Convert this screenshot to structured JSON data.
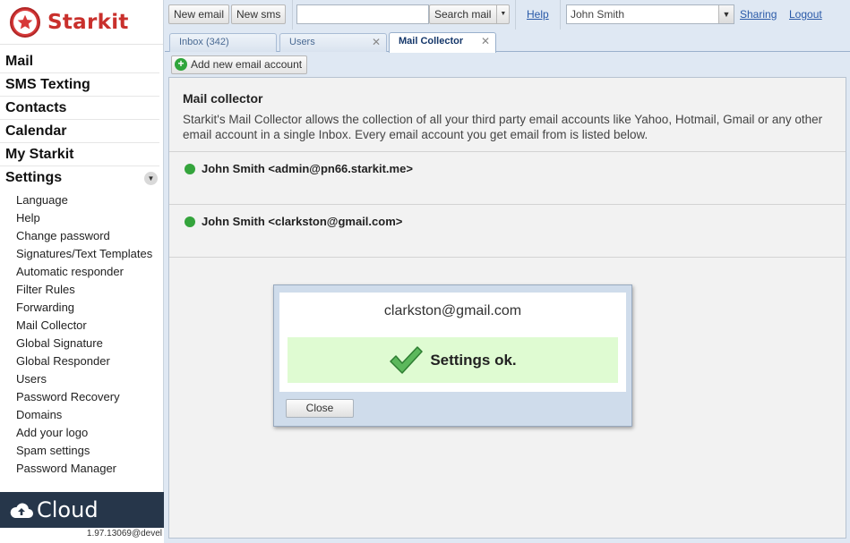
{
  "brand": {
    "name": "Starkit"
  },
  "nav": {
    "main": [
      "Mail",
      "SMS Texting",
      "Contacts",
      "Calendar",
      "My Starkit",
      "Settings"
    ],
    "settings_items": [
      "Language",
      "Help",
      "Change password",
      "Signatures/Text Templates",
      "Automatic responder",
      "Filter Rules",
      "Forwarding",
      "Mail Collector",
      "Global Signature",
      "Global Responder",
      "Users",
      "Password Recovery",
      "Domains",
      "Add your logo",
      "Spam settings",
      "Password Manager"
    ]
  },
  "footer": {
    "cloud_label": "Cloud",
    "version": "1.97.13069@devel"
  },
  "toolbar": {
    "new_email": "New email",
    "new_sms": "New sms",
    "search_value": "",
    "search_mail": "Search mail",
    "help": "Help",
    "user": "John Smith",
    "sharing": "Sharing",
    "logout": "Logout"
  },
  "tabs": [
    {
      "label": "Inbox (342)",
      "closable": false,
      "active": false
    },
    {
      "label": "Users",
      "closable": true,
      "active": false
    },
    {
      "label": "Mail Collector",
      "closable": true,
      "active": true
    }
  ],
  "actions": {
    "add_account": "Add new email account"
  },
  "mail_collector": {
    "title": "Mail collector",
    "description": "Starkit's Mail Collector allows the collection of all your third party email accounts like Yahoo, Hotmail, Gmail or any other email account in a single Inbox. Every email account you get email from is listed below.",
    "accounts": [
      {
        "label": "John Smith <admin@pn66.starkit.me>",
        "status_color": "#34a43c"
      },
      {
        "label": "John Smith <clarkston@gmail.com>",
        "status_color": "#34a43c"
      }
    ]
  },
  "dialog": {
    "email": "clarkston@gmail.com",
    "status": "Settings ok.",
    "close": "Close"
  },
  "colors": {
    "brand_red": "#c9302c",
    "success_bg": "#dffbd2",
    "status_green": "#34a43c",
    "link": "#2a5aa8"
  }
}
